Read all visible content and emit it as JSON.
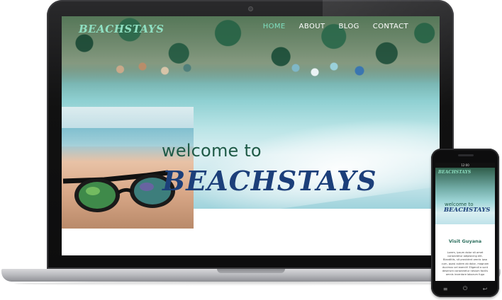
{
  "site": {
    "logo": "BEACHSTAYS",
    "nav": [
      {
        "label": "HOME",
        "active": true
      },
      {
        "label": "ABOUT",
        "active": false
      },
      {
        "label": "BLOG",
        "active": false
      },
      {
        "label": "CONTACT",
        "active": false
      }
    ],
    "hero": {
      "welcome": "welcome to",
      "brand": "BEACHSTAYS"
    }
  },
  "phone": {
    "status": "12:00",
    "logo": "BEACHSTAYS",
    "welcome": "welcome to",
    "brand": "BEACHSTAYS",
    "section_heading": "Visit Guyana",
    "body_text": "Lorem, ipsum dolor sit amet consectetur adipisicing elit. Blanditiis, sit provident omnis ipsa cum, quasi autem ab dolor, magnam ducimus vel exercit! Eligendi a sunt deserunt consectetur nesium facilis omnis inventore laborum fuga",
    "nav_icons": [
      "menu-icon",
      "home-icon",
      "back-icon"
    ]
  },
  "colors": {
    "nav_active": "#7fe0c0",
    "welcome_text": "#1e5a46",
    "brand_text": "#1c3f7a",
    "heading_green": "#2d6f5e"
  }
}
